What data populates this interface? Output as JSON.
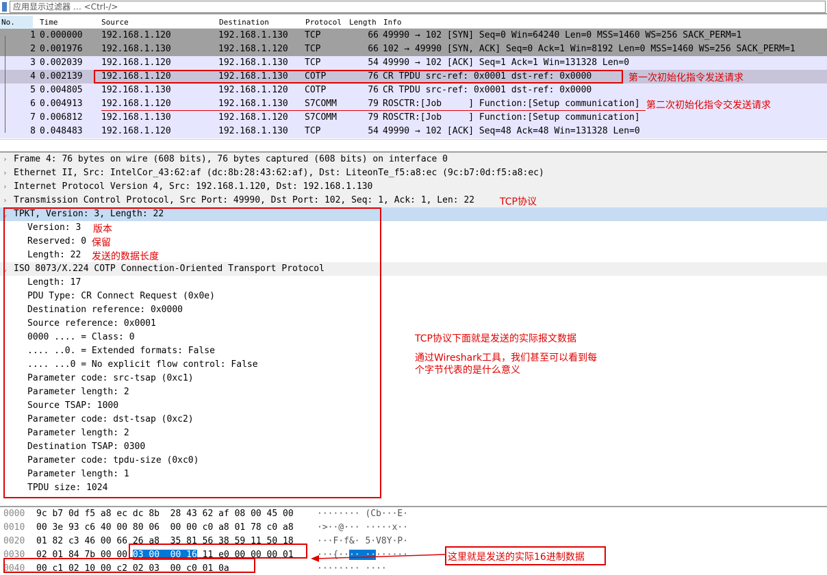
{
  "filter": {
    "placeholder": "应用显示过滤器 … <Ctrl-/>"
  },
  "columns": {
    "no": "No.",
    "time": "Time",
    "source": "Source",
    "destination": "Destination",
    "protocol": "Protocol",
    "length": "Length",
    "info": "Info"
  },
  "packets": [
    {
      "no": "1",
      "time": "0.000000",
      "src": "192.168.1.120",
      "dst": "192.168.1.130",
      "proto": "TCP",
      "len": "66",
      "info": "49990 → 102 [SYN] Seq=0 Win=64240 Len=0 MSS=1460 WS=256 SACK_PERM=1"
    },
    {
      "no": "2",
      "time": "0.001976",
      "src": "192.168.1.130",
      "dst": "192.168.1.120",
      "proto": "TCP",
      "len": "66",
      "info": "102 → 49990 [SYN, ACK] Seq=0 Ack=1 Win=8192 Len=0 MSS=1460 WS=256 SACK_PERM=1"
    },
    {
      "no": "3",
      "time": "0.002039",
      "src": "192.168.1.120",
      "dst": "192.168.1.130",
      "proto": "TCP",
      "len": "54",
      "info": "49990 → 102 [ACK] Seq=1 Ack=1 Win=131328 Len=0"
    },
    {
      "no": "4",
      "time": "0.002139",
      "src": "192.168.1.120",
      "dst": "192.168.1.130",
      "proto": "COTP",
      "len": "76",
      "info": "CR TPDU src-ref: 0x0001 dst-ref: 0x0000"
    },
    {
      "no": "5",
      "time": "0.004805",
      "src": "192.168.1.130",
      "dst": "192.168.1.120",
      "proto": "COTP",
      "len": "76",
      "info": "CR TPDU src-ref: 0x0001 dst-ref: 0x0000"
    },
    {
      "no": "6",
      "time": "0.004913",
      "src": "192.168.1.120",
      "dst": "192.168.1.130",
      "proto": "S7COMM",
      "len": "79",
      "info": "ROSCTR:[Job     ] Function:[Setup communication]"
    },
    {
      "no": "7",
      "time": "0.006812",
      "src": "192.168.1.130",
      "dst": "192.168.1.120",
      "proto": "S7COMM",
      "len": "79",
      "info": "ROSCTR:[Job     ] Function:[Setup communication]"
    },
    {
      "no": "8",
      "time": "0.048483",
      "src": "192.168.1.120",
      "dst": "192.168.1.130",
      "proto": "TCP",
      "len": "54",
      "info": "49990 → 102 [ACK] Seq=48 Ack=48 Win=131328 Len=0"
    }
  ],
  "details": [
    "Frame 4: 76 bytes on wire (608 bits), 76 bytes captured (608 bits) on interface 0",
    "Ethernet II, Src: IntelCor_43:62:af (dc:8b:28:43:62:af), Dst: LiteonTe_f5:a8:ec (9c:b7:0d:f5:a8:ec)",
    "Internet Protocol Version 4, Src: 192.168.1.120, Dst: 192.168.1.130",
    "Transmission Control Protocol, Src Port: 49990, Dst Port: 102, Seq: 1, Ack: 1, Len: 22",
    "TPKT, Version: 3, Length: 22",
    "Version: 3",
    "Reserved: 0",
    "Length: 22",
    "ISO 8073/X.224 COTP Connection-Oriented Transport Protocol",
    "Length: 17",
    "PDU Type: CR Connect Request (0x0e)",
    "Destination reference: 0x0000",
    "Source reference: 0x0001",
    "0000 .... = Class: 0",
    ".... ..0. = Extended formats: False",
    ".... ...0 = No explicit flow control: False",
    "Parameter code: src-tsap (0xc1)",
    "Parameter length: 2",
    "Source TSAP: 1000",
    "Parameter code: dst-tsap (0xc2)",
    "Parameter length: 2",
    "Destination TSAP: 0300",
    "Parameter code: tpdu-size (0xc0)",
    "Parameter length: 1",
    "TPDU size: 1024"
  ],
  "hex": [
    {
      "off": "0000",
      "bytes": "9c b7 0d f5 a8 ec dc 8b  28 43 62 af 08 00 45 00",
      "ascii": "········ (Cb···E·"
    },
    {
      "off": "0010",
      "bytes": "00 3e 93 c6 40 00 80 06  00 00 c0 a8 01 78 c0 a8",
      "ascii": "·>··@··· ·····x··"
    },
    {
      "off": "0020",
      "bytes": "01 82 c3 46 00 66 26 a8  35 81 56 38 59 11 50 18",
      "ascii": "···F·f&· 5·V8Y·P·"
    },
    {
      "off": "0030",
      "bytes_pre": "02 01 84 7b 00 00 ",
      "bytes_hl": "03 00  00 16",
      "bytes_post": " 11 e0 00 00 00 01",
      "ascii_pre": "···{··",
      "ascii_hl": "·· ··",
      "ascii_post": "······"
    },
    {
      "off": "0040",
      "bytes": "00 c1 02 10 00 c2 02 03  00 c0 01 0a",
      "ascii": "········ ····"
    }
  ],
  "annotations": {
    "first_init": "第一次初始化指令发送请求",
    "second_init": "第二次初始化指令交发送请求",
    "tcp": "TCP协议",
    "version": "版本",
    "reserved": "保留",
    "length": "发送的数据长度",
    "payload1": "TCP协议下面就是发送的实际报文数据",
    "payload2a": "通过Wireshark工具，我们甚至可以看到每",
    "payload2b": "个字节代表的是什么意义",
    "hex_note": "这里就是发送的实际16进制数据"
  },
  "colors": {
    "accent": "#e00000",
    "selected": "#c5dcf3",
    "tcp_syn": "#a0a0a0",
    "row": "#e7e6ff"
  }
}
